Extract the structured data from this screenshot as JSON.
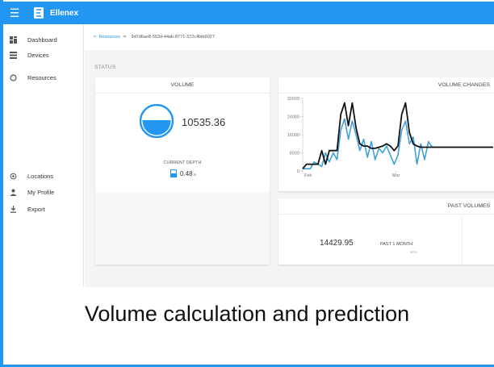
{
  "app": {
    "title": "Ellenex"
  },
  "sidebar": {
    "items": [
      {
        "label": "Dashboard",
        "icon": "dashboard-icon"
      },
      {
        "label": "Devices",
        "icon": "devices-icon"
      },
      {
        "label": "Resources",
        "icon": "resources-icon"
      },
      {
        "label": "Locations",
        "icon": "location-icon"
      },
      {
        "label": "My Profile",
        "icon": "person-icon"
      },
      {
        "label": "Export",
        "icon": "download-icon"
      }
    ]
  },
  "breadcrumb": {
    "link": "Resources",
    "id": "9d7d6ae8-553d-44ab-8771-372c4bfe6027"
  },
  "status": {
    "label": "STATUS"
  },
  "volume_card": {
    "title": "VOLUME",
    "value": "10535.36",
    "depth_label": "CURRENT DEPTH",
    "depth_value": "0.48",
    "depth_unit": "m"
  },
  "volume_changes": {
    "title": "VOLUME CHANGES"
  },
  "past_volumes": {
    "title": "PAST VOLUMES",
    "value": "14429.95",
    "period": "PAST 1 MONTH",
    "sub": "MTRL"
  },
  "caption": "Volume calculation and prediction",
  "colors": {
    "accent": "#2196f3",
    "series_blue": "#3fa0d8",
    "series_black": "#111111"
  },
  "chart_data": {
    "type": "line",
    "x_tick_labels": [
      "Feb",
      "Mar"
    ],
    "ylim": [
      0,
      32000
    ],
    "y_ticks": [
      0,
      8000,
      16000,
      24000,
      32000
    ],
    "y_tick_labels": [
      "0",
      "8000",
      "16000",
      "24000",
      "32000"
    ],
    "grid": false,
    "legend": "none",
    "x": [
      0,
      2,
      4,
      6,
      8,
      10,
      12,
      14,
      16,
      18,
      20,
      22,
      24,
      26,
      28,
      30,
      32,
      34,
      36,
      38,
      40,
      42,
      44,
      46,
      48,
      50,
      52,
      54,
      56,
      58,
      60,
      62,
      64,
      66,
      68,
      70,
      72,
      74,
      76,
      78,
      80,
      82,
      84,
      86,
      88,
      90,
      92,
      94,
      96,
      98,
      100
    ],
    "series": [
      {
        "color": "#111111",
        "values": [
          1000,
          3000,
          3000,
          3000,
          3000,
          9000,
          3000,
          9000,
          9000,
          9000,
          25000,
          30000,
          20000,
          30000,
          19000,
          12000,
          11000,
          11000,
          10000,
          10000,
          10500,
          11000,
          12000,
          11000,
          9000,
          11000,
          25000,
          30000,
          17000,
          12000,
          11000,
          10500,
          10500,
          10500,
          10500,
          10500,
          10500,
          10500,
          10500,
          10500,
          10500,
          10500,
          10500,
          10500,
          10500,
          10500,
          10500,
          10500,
          10500,
          10500,
          10500
        ]
      },
      {
        "color": "#3fa0d8",
        "values": [
          1000,
          1000,
          1000,
          4000,
          3000,
          2000,
          8000,
          4000,
          8000,
          5000,
          18000,
          23000,
          14000,
          22000,
          16000,
          9000,
          14000,
          6000,
          13000,
          5000,
          10000,
          8000,
          11000,
          7000,
          3000,
          7000,
          18000,
          22000,
          12000,
          15000,
          3000,
          12000,
          5000,
          13000,
          10500,
          10500,
          10500,
          10500,
          10500,
          10500,
          10500,
          10500,
          10500,
          10500,
          10500,
          10500,
          10500,
          10500,
          10500,
          10500,
          10500
        ]
      }
    ]
  }
}
